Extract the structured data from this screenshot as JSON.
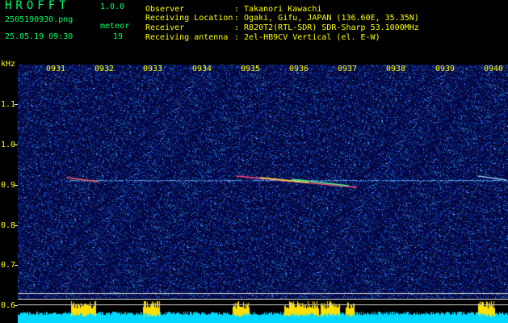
{
  "app": {
    "name": "HROFFT",
    "version": "1.0.0"
  },
  "file": {
    "name": "2505190930.png",
    "timestamp": "25.05.19 09:30"
  },
  "detection": {
    "label": "meteor",
    "count": "19"
  },
  "info": {
    "observer_label": "Observer",
    "observer_value": ": Takanori Kawachi",
    "location_label": "Receiving Location",
    "location_value": ": Ogaki, Gifu, JAPAN (136.60E, 35.35N)",
    "receiver_label": "Receiver",
    "receiver_value": ": R820T2(RTL-SDR) SDR-Sharp 53.1000MHz",
    "antenna_label": "Receiving antenna",
    "antenna_value": ": 2el-HB9CV Vertical (el. E-W)"
  },
  "axis": {
    "unit": "kHz",
    "y_ticks": [
      "1.1",
      "1.0",
      "0.9",
      "0.8",
      "0.7",
      "0.6"
    ],
    "x_ticks": [
      "0931",
      "0932",
      "0933",
      "0934",
      "0935",
      "0936",
      "0937",
      "0938",
      "0939",
      "0940"
    ]
  },
  "colors": {
    "text_green": "#00ff66",
    "text_yellow": "#ffff00",
    "background": "#000000",
    "spectrum_noise": "#0a1a8c",
    "band_fill": "#00d8ff",
    "band_peak": "#ffe000"
  }
}
